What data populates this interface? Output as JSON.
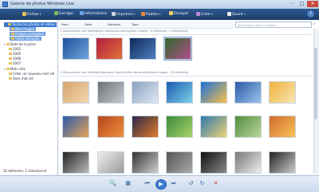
{
  "window": {
    "title": "Galerie de photos Windows Live",
    "controls": [
      "–",
      "□",
      "✕"
    ]
  },
  "toolbar": {
    "items": [
      {
        "label": "Fichier",
        "icon": "folder-icon",
        "color": "#e9c25a"
      },
      {
        "label": "Corriger",
        "icon": "fix-icon",
        "color": "#7bbf5a"
      },
      {
        "label": "Informations",
        "icon": "info-icon",
        "color": "#6aa6e8"
      },
      {
        "label": "Imprimer",
        "icon": "print-icon",
        "color": "#c9d6e6"
      },
      {
        "label": "Publier",
        "icon": "publish-icon",
        "color": "#e98a3a"
      },
      {
        "label": "Envoyer",
        "icon": "email-icon",
        "color": "#f0d36a"
      },
      {
        "label": "Créer",
        "icon": "create-icon",
        "color": "#b98ad8"
      },
      {
        "label": "Ouvrir",
        "icon": "open-icon",
        "color": "#f0f0f0"
      }
    ],
    "help": "?"
  },
  "nav": {
    "tree": [
      {
        "label": "Toutes les photos et vidéos",
        "state": "selected"
      },
      {
        "label": "Mes images",
        "state": "selected-child"
      },
      {
        "label": "Images partagées",
        "state": "selected-child"
      },
      {
        "label": "Vidéo partagée",
        "state": "selected-child"
      },
      {
        "label": "Date de la prise",
        "state": "normal"
      },
      {
        "label": "2001",
        "state": "normal"
      },
      {
        "label": "2005",
        "state": "normal"
      },
      {
        "label": "2006",
        "state": "normal"
      },
      {
        "label": "2007",
        "state": "normal"
      },
      {
        "label": "Mots clés",
        "state": "normal"
      },
      {
        "label": "Créer un nouveau mot clé",
        "state": "normal"
      },
      {
        "label": "Sans mot clé",
        "state": "normal"
      }
    ]
  },
  "content": {
    "columns": [
      "Nom",
      "Date",
      "Notation",
      "Type"
    ],
    "search_placeholder": "Rechercher dans la Galerie",
    "groups": [
      {
        "path": "C:\\Documents and Settings\\All Users\\Documents\\Mes images - 4 éléments, 1 sélectionné"
      },
      {
        "path": "C:\\Documents and Settings\\Stephane Fourche\\Mes documents\\Mes images - 31 éléments"
      }
    ],
    "thumbs1": [
      {
        "c": [
          "#1d4f9a",
          "#6fa6dd"
        ],
        "sel": false
      },
      {
        "c": [
          "#b21e3a",
          "#e0723c"
        ],
        "sel": false
      },
      {
        "c": [
          "#0f2a5c",
          "#4d7fc0"
        ],
        "sel": false
      },
      {
        "c": [
          "#2e6b2a",
          "#b24b8d"
        ],
        "sel": true
      }
    ],
    "thumbs2": [
      {
        "c": [
          "#d7a46b",
          "#f2d8b2"
        ]
      },
      {
        "c": [
          "#6d6f76",
          "#c8cbd0"
        ]
      },
      {
        "c": [
          "#8aa1bf",
          "#dfe8f3"
        ]
      },
      {
        "c": [
          "#1a5ab0",
          "#7fd0e8"
        ]
      },
      {
        "c": [
          "#1b6fd8",
          "#f7c14a"
        ]
      },
      {
        "c": [
          "#2c5aa8",
          "#9ac3ea"
        ]
      },
      {
        "c": [
          "#f0b23a",
          "#f7e6b3"
        ]
      },
      {
        "c": [
          "#2a5ca8",
          "#e8a25a"
        ]
      },
      {
        "c": [
          "#b5461f",
          "#f08f3c"
        ]
      },
      {
        "c": [
          "#2a2a4a",
          "#e07a2a"
        ]
      },
      {
        "c": [
          "#3b8a3a",
          "#a9d46a"
        ]
      },
      {
        "c": [
          "#2b7aa8",
          "#f2d27a"
        ]
      },
      {
        "c": [
          "#4f8a3e",
          "#bcd89a"
        ]
      },
      {
        "c": [
          "#d26a2a",
          "#f6c35a"
        ]
      },
      {
        "c": [
          "#222222",
          "#bbbbbb"
        ]
      },
      {
        "c": [
          "#eeeeee",
          "#9a9a9a"
        ]
      },
      {
        "c": [
          "#333333",
          "#d0d0d0"
        ]
      },
      {
        "c": [
          "#555555",
          "#aaaaaa"
        ]
      },
      {
        "c": [
          "#111111",
          "#888888"
        ]
      },
      {
        "c": [
          "#777777",
          "#eeeeee"
        ]
      },
      {
        "c": [
          "#222222",
          "#cccccc"
        ]
      }
    ]
  },
  "status": {
    "text": "35 éléments, 1 sélectionné"
  },
  "bottom": {
    "buttons": [
      "🔍",
      "▦",
      "⏮",
      "▶",
      "⏭",
      "↺",
      "↻",
      "✕"
    ]
  }
}
